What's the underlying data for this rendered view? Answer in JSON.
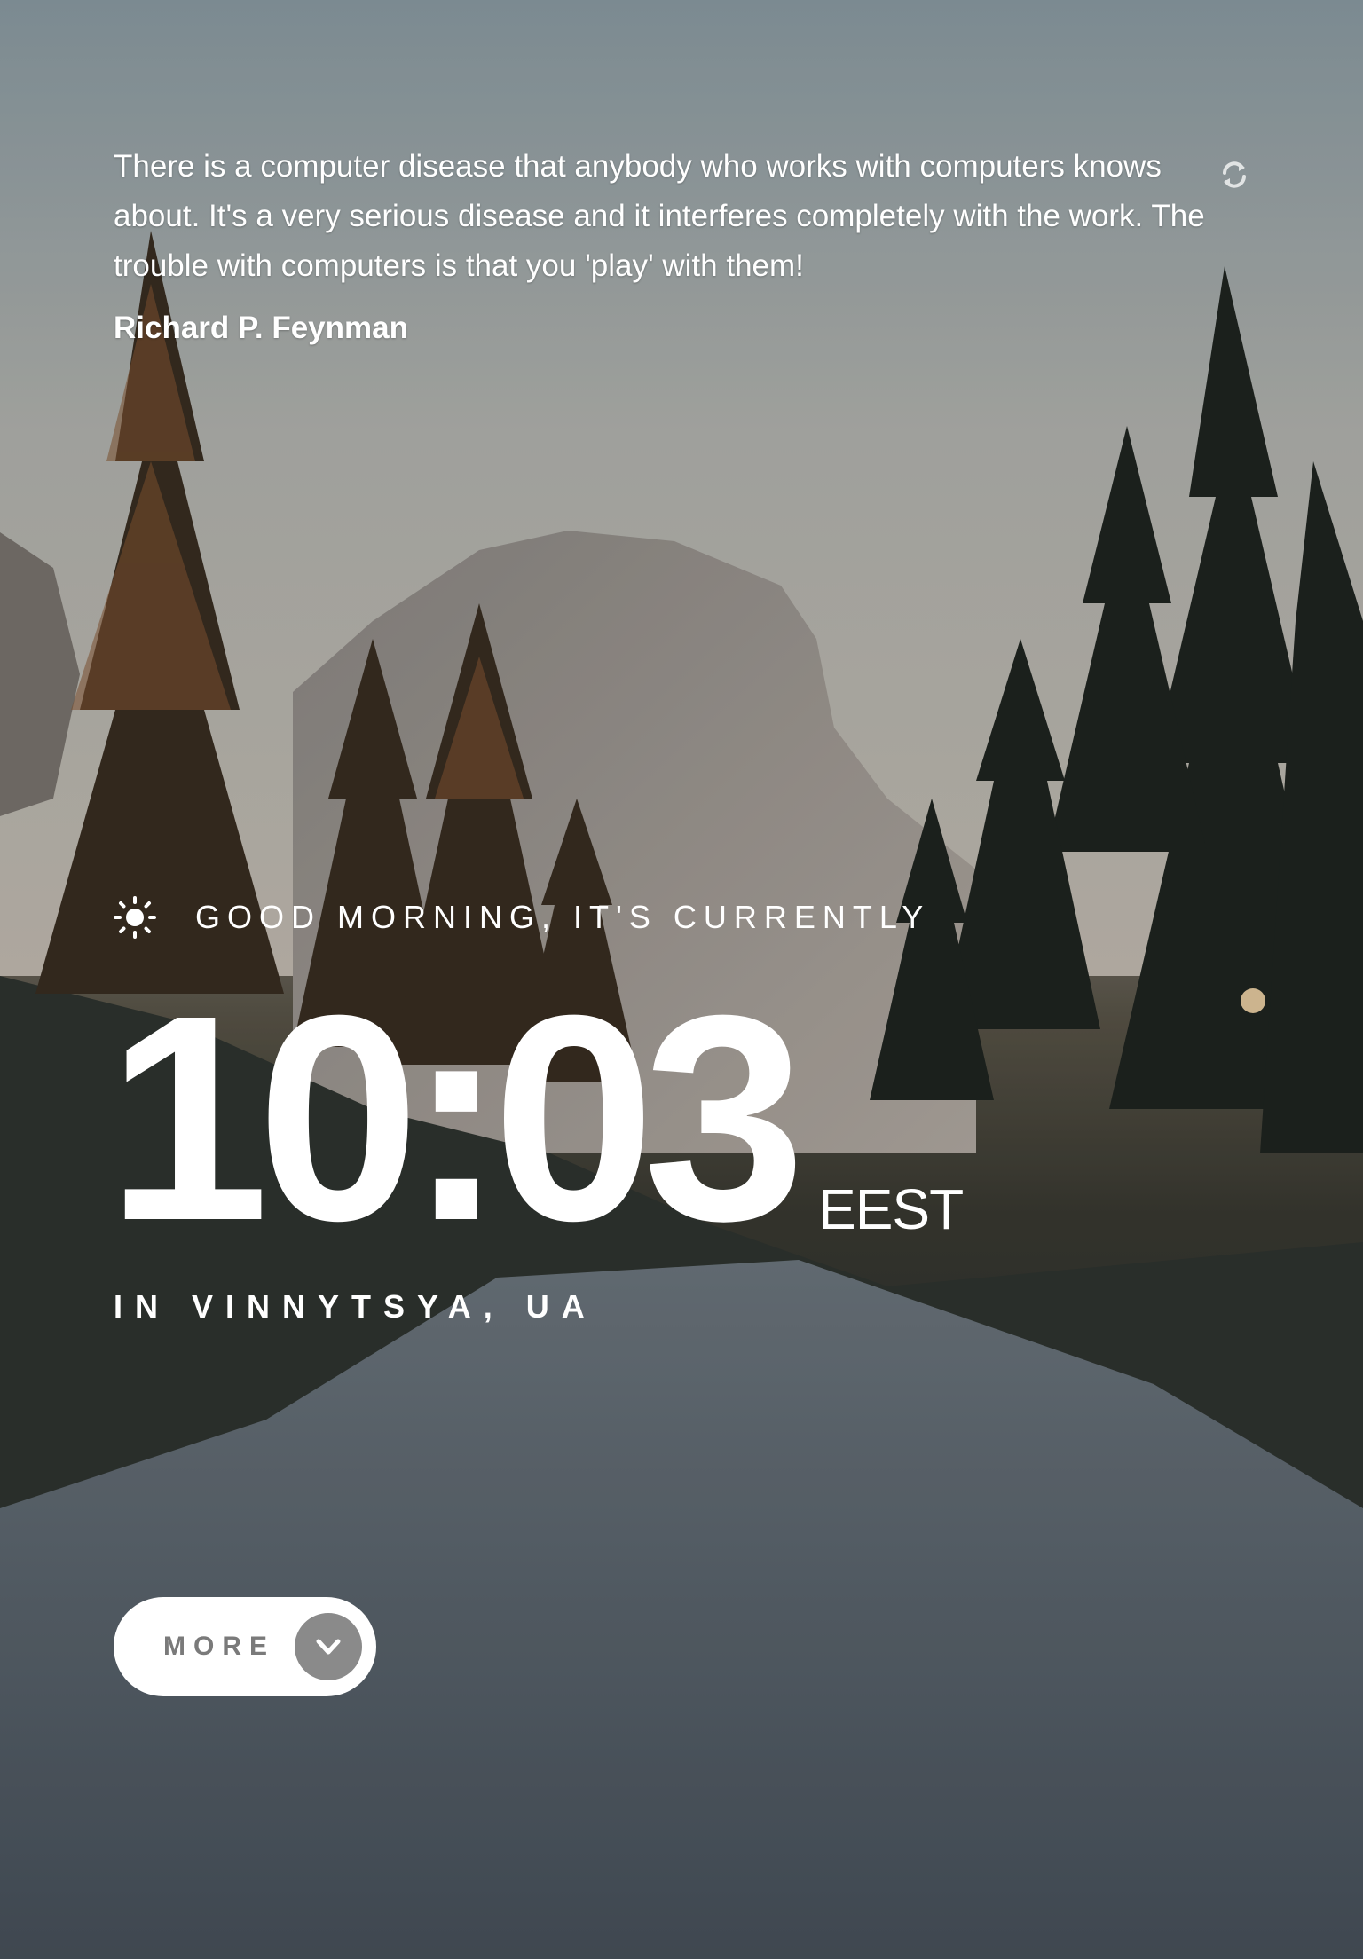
{
  "quote": {
    "text": "There is a computer disease that anybody who works with computers knows about. It's a very serious disease and it interferes completely with the work. The trouble with computers is that you 'play' with them!",
    "author": "Richard P. Feynman"
  },
  "refresh_icon": "refresh-icon",
  "greeting": {
    "icon": "sun-icon",
    "text": "Good morning, it's currently"
  },
  "clock": {
    "time": "10:03",
    "timezone": "EEST"
  },
  "location": {
    "text": "in Vinnytsya, UA"
  },
  "more_button": {
    "label": "MORE",
    "icon": "chevron-down-icon"
  },
  "colors": {
    "text": "#ffffff",
    "button_bg": "#ffffff",
    "button_text": "#7a7a7a",
    "button_circle": "#8a8a8a"
  }
}
